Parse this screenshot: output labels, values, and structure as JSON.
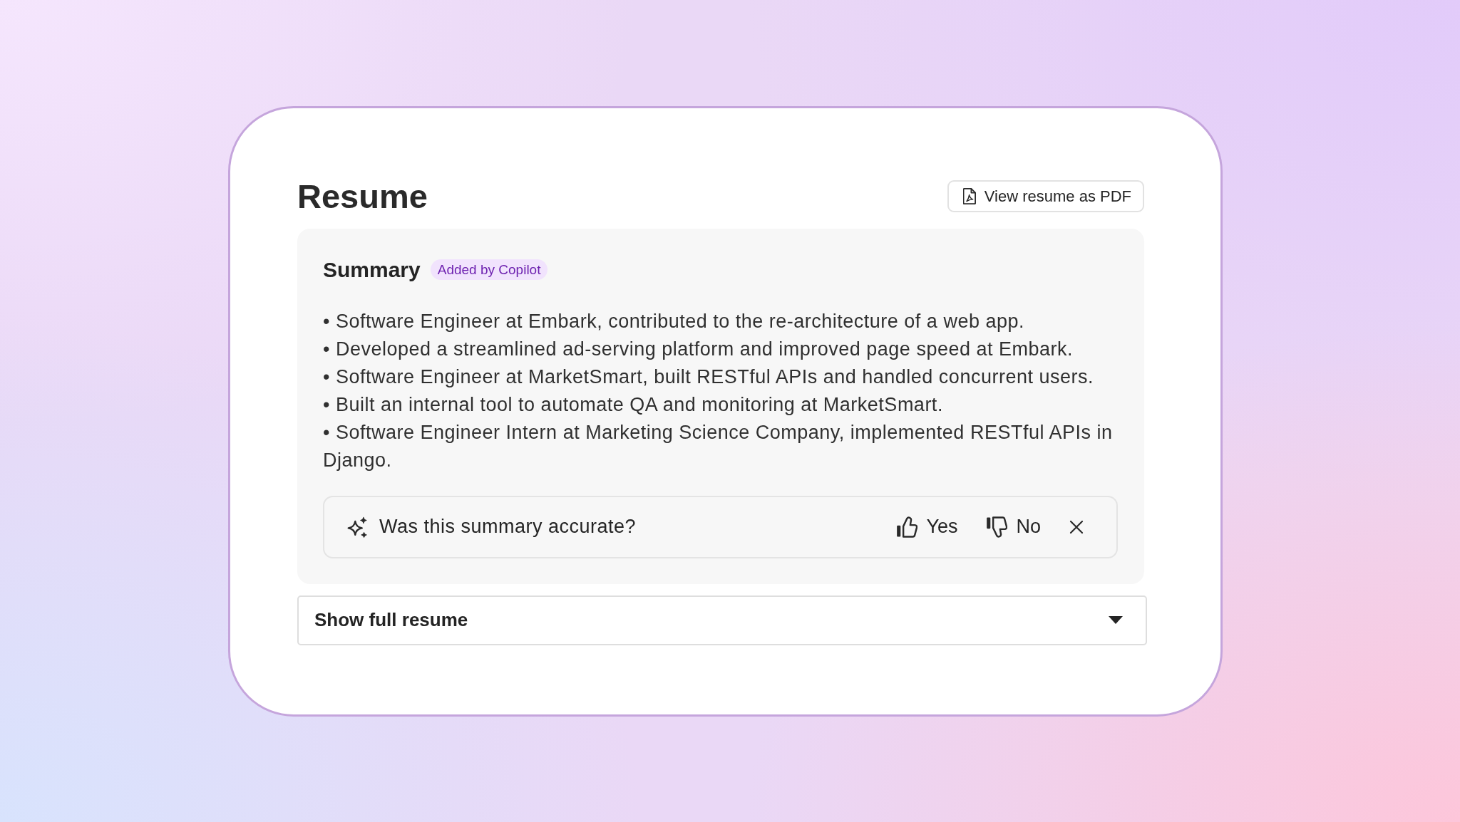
{
  "card": {
    "title": "Resume",
    "pdf_button": {
      "label": "View resume as PDF"
    },
    "summary": {
      "heading": "Summary",
      "badge": "Added by Copilot",
      "bullets": [
        "• Software Engineer at Embark, contributed to the re-architecture of a web app.",
        "• Developed a streamlined ad-serving platform and improved page speed at Embark.",
        "• Software Engineer at MarketSmart, built RESTful APIs and handled concurrent users.",
        "• Built an internal tool to automate QA and monitoring at MarketSmart.",
        "• Software Engineer Intern at Marketing Science Company, implemented RESTful APIs in Django."
      ],
      "feedback": {
        "question": "Was this summary accurate?",
        "actions": [
          {
            "kind": "thumbs_up",
            "label": "Yes"
          },
          {
            "kind": "thumbs_down",
            "label": "No"
          }
        ]
      }
    },
    "expander": {
      "label": "Show full resume",
      "expanded": false
    }
  }
}
